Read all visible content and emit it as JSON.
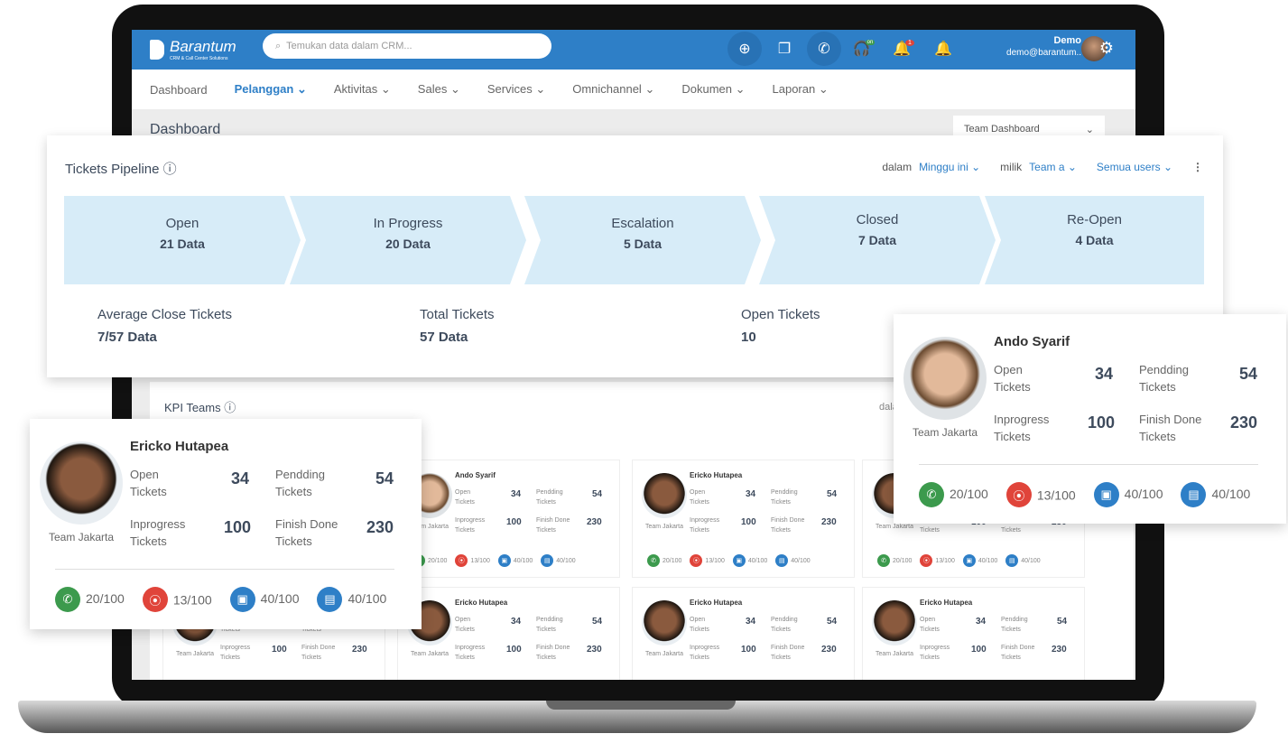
{
  "app": {
    "logo": "Barantum",
    "tagline": "CRM & Call Center Solutions",
    "search_placeholder": "Temukan data dalam CRM...",
    "user_name": "Demo",
    "user_email": "demo@barantum..",
    "notif_count": "1",
    "status_badge": "on"
  },
  "nav": [
    "Dashboard",
    "Pelanggan",
    "Aktivitas",
    "Sales",
    "Services",
    "Omnichannel",
    "Dokumen",
    "Laporan"
  ],
  "page": {
    "title": "Dashboard",
    "dashboard_select": "Team Dashboard"
  },
  "pipeline": {
    "title": "Tickets Pipeline",
    "filter_prefix": "dalam",
    "period": "Minggu ini",
    "owner_prefix": "milik",
    "team": "Team a",
    "users": "Semua users",
    "stages": [
      {
        "name": "Open",
        "value": "21 Data"
      },
      {
        "name": "In Progress",
        "value": "20 Data"
      },
      {
        "name": "Escalation",
        "value": "5 Data"
      },
      {
        "name": "Closed",
        "value": "7 Data"
      },
      {
        "name": "Re-Open",
        "value": "4 Data"
      }
    ],
    "summary": [
      {
        "label": "Average Close Tickets",
        "value": "7/57 Data"
      },
      {
        "label": "Total Tickets",
        "value": "57 Data"
      },
      {
        "label": "Open Tickets",
        "value": "10"
      }
    ]
  },
  "kpi": {
    "title": "KPI Teams",
    "filter_prefix": "dalam",
    "labels": {
      "open": "Open Tickets",
      "pending": "Pendding Tickets",
      "inprogress": "Inprogress Tickets",
      "finish": "Finish Done Tickets",
      "team": "Team Jakarta"
    },
    "stats": {
      "open": "34",
      "pending": "54",
      "inprogress": "100",
      "finish": "230",
      "calls": "20/100",
      "visits": "13/100",
      "deals": "40/100",
      "tasks": "40/100"
    },
    "cards": [
      "Ericko Hutapea",
      "Ando Syarif",
      "Ericko Hutapea",
      "Ericko Hutapea",
      "Ericko Hutapea",
      "Ericko Hutapea",
      "Ericko Hutapea",
      "Ericko Hutapea"
    ],
    "popups": [
      "Ericko Hutapea",
      "Ando Syarif"
    ]
  },
  "colors": {
    "brand": "#2e7fc7",
    "stage": "#d7ecf8",
    "call": "#3c9a4d",
    "visit": "#e0443a",
    "task": "#2e7fc7"
  }
}
